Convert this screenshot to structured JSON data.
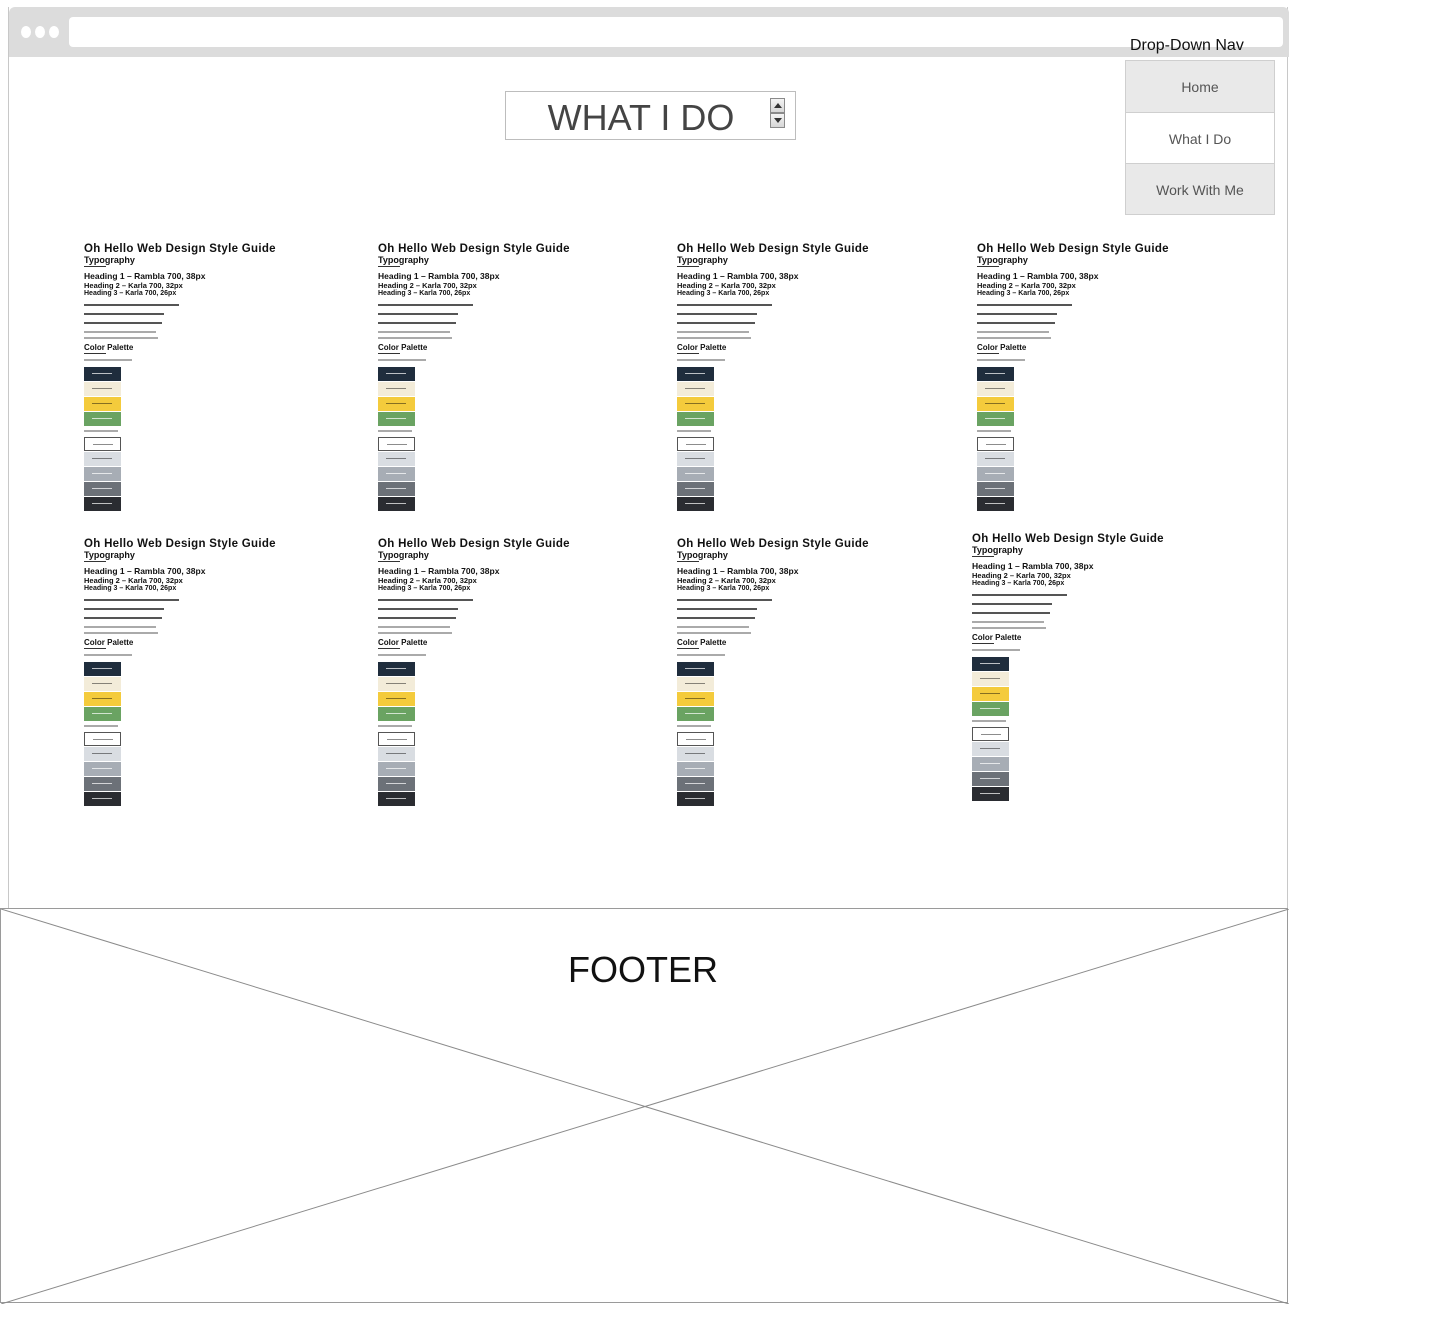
{
  "header": {
    "title": "WHAT I DO"
  },
  "nav": {
    "title": "Drop-Down Nav",
    "items": [
      {
        "label": "Home"
      },
      {
        "label": "What I Do"
      },
      {
        "label": "Work With Me"
      }
    ]
  },
  "thumbnails": {
    "title": "Oh Hello Web Design Style Guide",
    "subtitle": "Typography",
    "heading1": "Heading 1 – Rambla 700, 38px",
    "heading2": "Heading 2 – Karla 700, 32px",
    "heading3": "Heading 3 – Karla 700, 26px",
    "palette_title": "Color Palette",
    "primary_colors": [
      "#1f2d3d",
      "#f3ecd9",
      "#f4cb3c",
      "#6aa362"
    ],
    "neutral_colors": [
      "#ffffff",
      "#d9dde2",
      "#a7adb5",
      "#6c7178",
      "#2a2c31"
    ],
    "count": 8
  },
  "footer": {
    "label": "FOOTER"
  }
}
